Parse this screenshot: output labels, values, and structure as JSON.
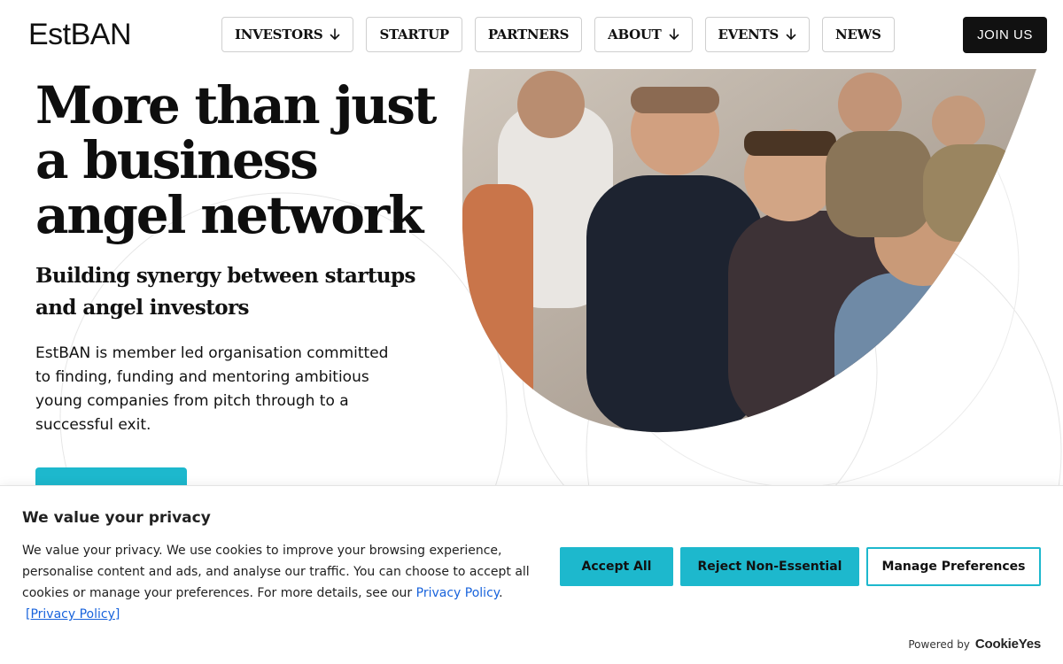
{
  "header": {
    "logo_text": "EstBAN",
    "nav": [
      {
        "label": "INVESTORS",
        "has_arrow": true
      },
      {
        "label": "STARTUP",
        "has_arrow": false
      },
      {
        "label": "PARTNERS",
        "has_arrow": false
      },
      {
        "label": "ABOUT",
        "has_arrow": true
      },
      {
        "label": "EVENTS",
        "has_arrow": true
      },
      {
        "label": "NEWS",
        "has_arrow": false
      }
    ],
    "join_label": "JOIN US"
  },
  "hero": {
    "title": "More than just a business angel network",
    "subtitle": "Building synergy between startups and angel investors",
    "body": "EstBAN is member led organisation committed to finding, funding and mentoring ambitious young companies from pitch through to a successful exit."
  },
  "cookie": {
    "title": "We value your privacy",
    "text": "We value your privacy. We use cookies to improve your browsing experience, personalise content and ads, and analyse our traffic. You can choose to accept all cookies or manage your preferences. For more details, see our",
    "privacy_link": "Privacy Policy",
    "privacy_link_bracketed": "[Privacy Policy]",
    "accept_label": "Accept All",
    "reject_label": "Reject Non-Essential",
    "manage_label": "Manage Preferences",
    "powered_by": "Powered by",
    "powered_brand": "CookieYes"
  },
  "colors": {
    "accent": "#1db8cd",
    "link": "#1863dc",
    "dark": "#111111"
  }
}
